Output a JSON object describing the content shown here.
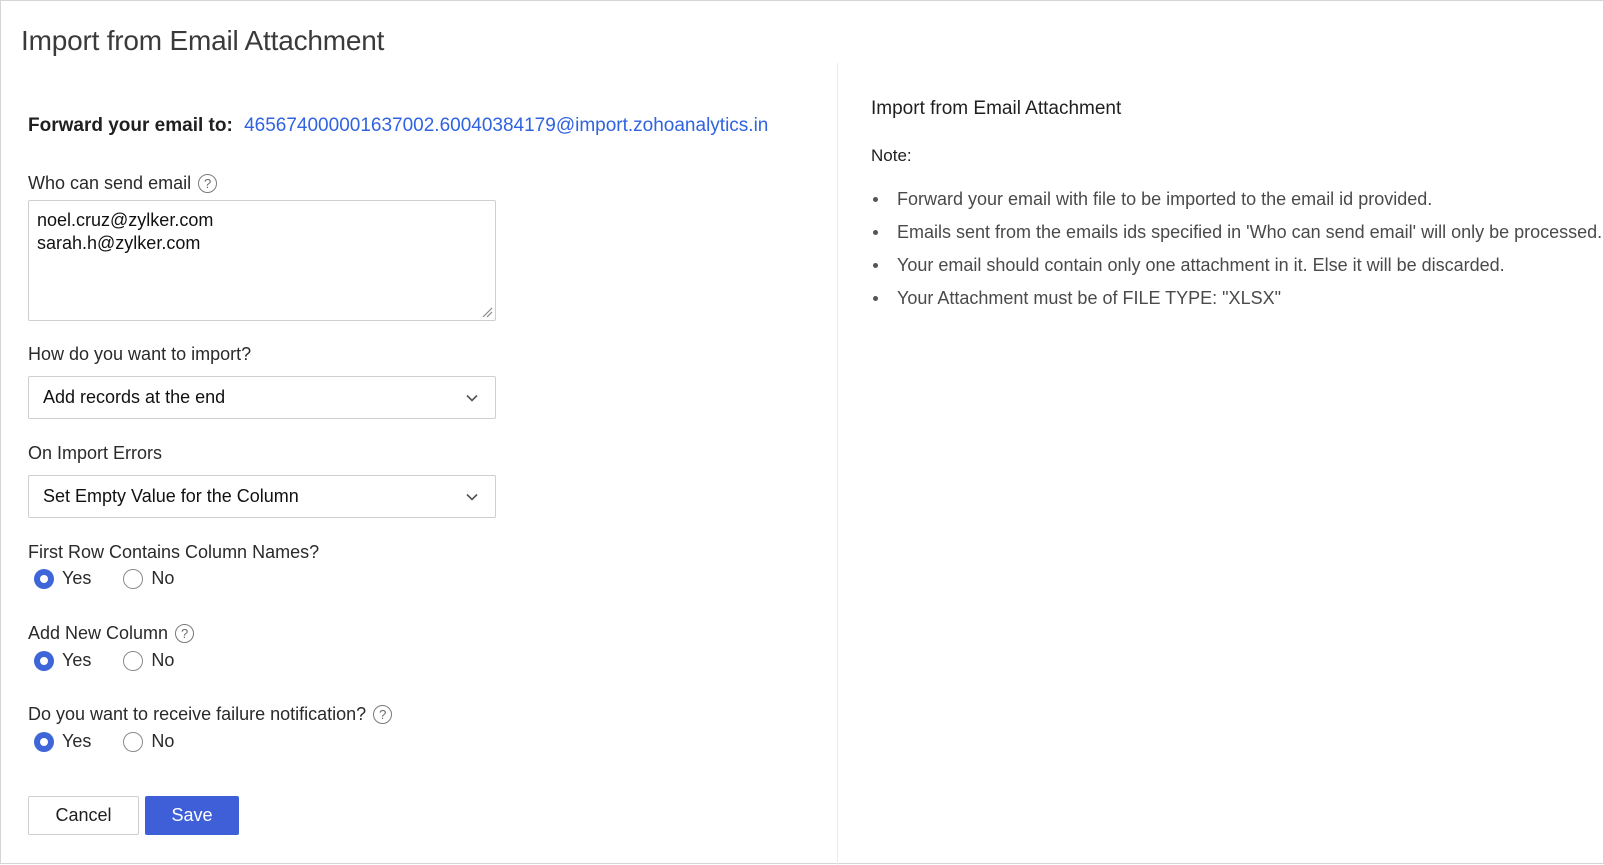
{
  "page": {
    "title": "Import from Email Attachment"
  },
  "form": {
    "forward_label": "Forward your email to:",
    "forward_address": "465674000001637002.60040384179@import.zohoanalytics.in",
    "who_can_send": {
      "label": "Who can send email",
      "emails": [
        "noel.cruz@zylker.com",
        "sarah.h@zylker.com"
      ]
    },
    "import_mode": {
      "label": "How do you want to import?",
      "selected": "Add records at the end"
    },
    "on_errors": {
      "label": "On Import Errors",
      "selected": "Set Empty Value for the Column"
    },
    "first_row": {
      "label": "First Row Contains Column Names?",
      "yes": "Yes",
      "no": "No",
      "value": "Yes"
    },
    "add_column": {
      "label": "Add New Column",
      "yes": "Yes",
      "no": "No",
      "value": "Yes"
    },
    "failure_notify": {
      "label": "Do you want to receive failure notification?",
      "yes": "Yes",
      "no": "No",
      "value": "Yes"
    },
    "cancel_label": "Cancel",
    "save_label": "Save"
  },
  "help": {
    "title": "Import from Email Attachment",
    "note_label": "Note:",
    "notes": [
      "Forward your email with file to be imported to the email id provided.",
      "Emails sent from the emails ids specified in 'Who can send email' will only be processed.",
      "Your email should contain only one attachment in it. Else it will be discarded.",
      "Your Attachment must be of FILE TYPE: \"XLSX\""
    ]
  },
  "colors": {
    "accent": "#3f5fd8",
    "link": "#2f63e0"
  },
  "icons": {
    "help": "question-circle-icon",
    "dropdown": "chevron-down-icon"
  }
}
